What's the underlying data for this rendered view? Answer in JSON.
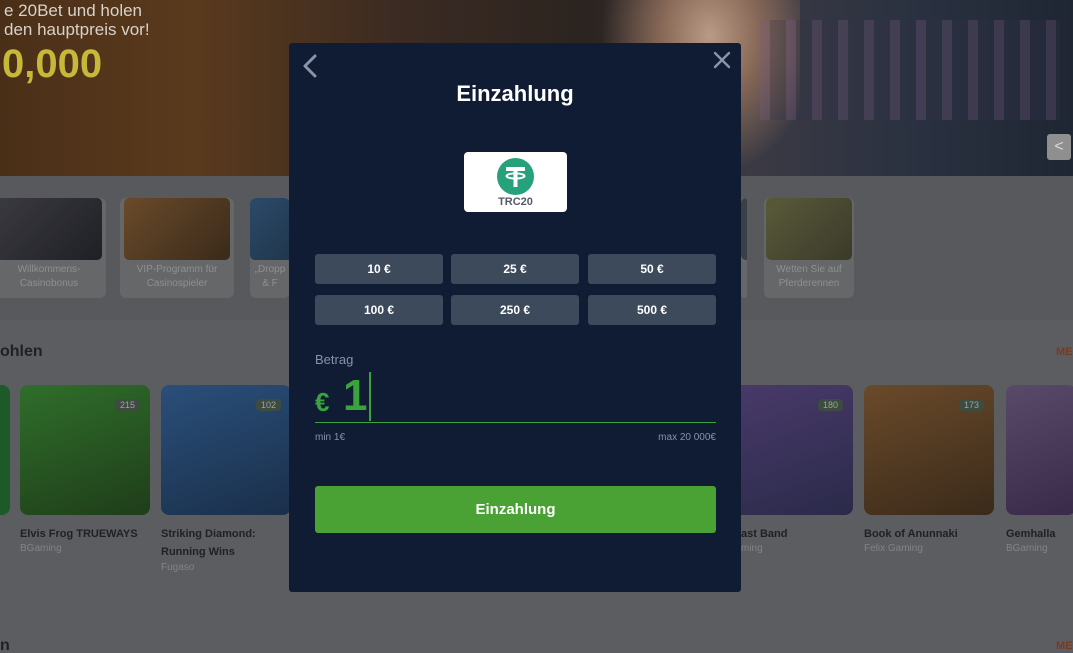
{
  "background": {
    "hero": {
      "line1": "e 20Bet und holen",
      "line2": "den hauptpreis vor!",
      "prize": "0,000",
      "next_arrow": "<"
    },
    "promos": [
      {
        "caption": "Willkommens-\nCasinobonus"
      },
      {
        "caption": "VIP-Programm für\nCasinospieler"
      },
      {
        "caption": "„Dropp\n& F"
      },
      {
        "caption": "Wetten Sie auf\nPferderennen"
      }
    ],
    "section_title": "ohlen",
    "see_all": "MEH",
    "games": [
      {
        "title": "Elvis Frog TRUEWAYS",
        "provider": "BGaming",
        "badge": "215"
      },
      {
        "title": "Striking Diamond:\nRunning Wins",
        "provider": "Fugaso",
        "badge": "102"
      },
      {
        "title": "ast Band",
        "provider": "ming",
        "badge": "180"
      },
      {
        "title": "Book of Anunnaki",
        "provider": "Felix Gaming",
        "badge": "173"
      },
      {
        "title": "Gemhalla",
        "provider": "BGaming",
        "badge": ""
      }
    ],
    "lower_title": "n",
    "lower_see_all": "MEH"
  },
  "modal": {
    "title": "Einzahlung",
    "method": {
      "label": "TRC20",
      "icon": "tether-icon",
      "color": "#26a17b"
    },
    "amount_buttons": [
      "10 €",
      "25 €",
      "50 €",
      "100 €",
      "250 €",
      "500 €"
    ],
    "amount_label": "Betrag",
    "currency": "€",
    "amount_value": "1",
    "min": "min 1€",
    "max": "max 20 000€",
    "submit": "Einzahlung",
    "accent": "#3aa33b",
    "bg": "#0f1c33"
  }
}
